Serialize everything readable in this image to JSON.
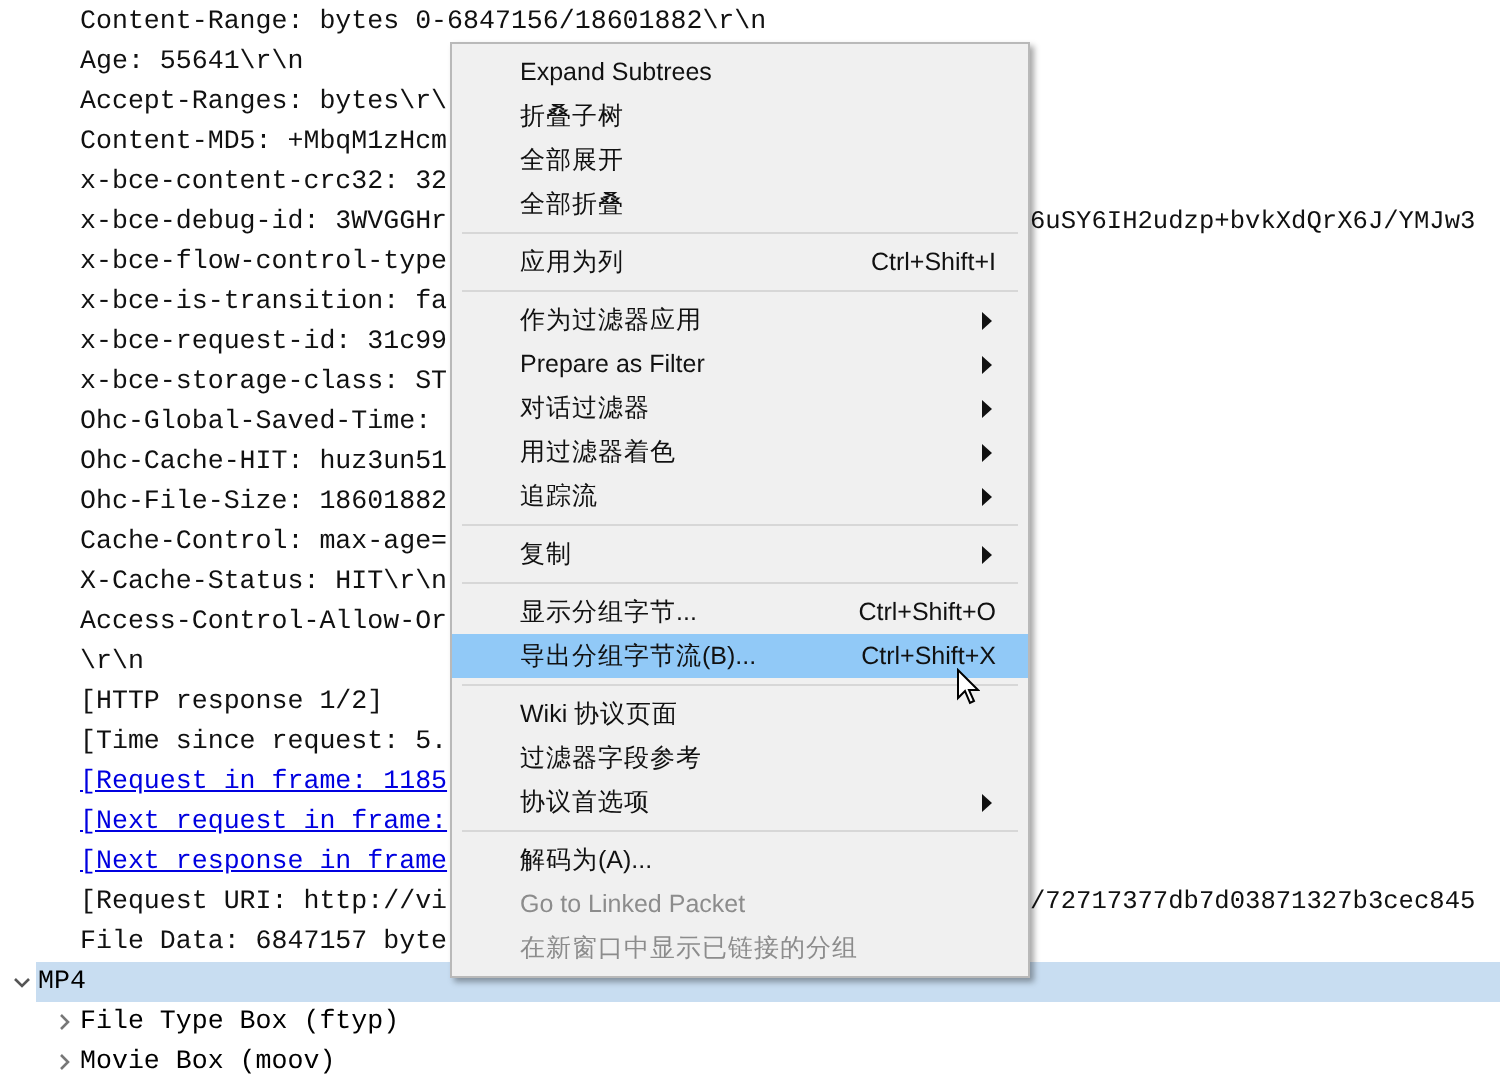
{
  "tree": [
    {
      "kind": "field",
      "text": "Content-Range: bytes 0-6847156/18601882\\r\\n",
      "selected": false
    },
    {
      "kind": "field",
      "text": "Age: 55641\\r\\n",
      "selected": false
    },
    {
      "kind": "field",
      "text": "Accept-Ranges: bytes\\r\\",
      "selected": false
    },
    {
      "kind": "field",
      "text": "Content-MD5: +MbqM1zHcm",
      "selected": false
    },
    {
      "kind": "field",
      "text": "x-bce-content-crc32: 32",
      "selected": false
    },
    {
      "kind": "field",
      "text": "x-bce-debug-id: 3WVGGHr",
      "right_text": "6uSY6IH2udzp+bvkXdQrX6J/YMJw3",
      "selected": false
    },
    {
      "kind": "field",
      "text": "x-bce-flow-control-type",
      "selected": false
    },
    {
      "kind": "field",
      "text": "x-bce-is-transition: fa",
      "selected": false
    },
    {
      "kind": "field",
      "text": "x-bce-request-id: 31c99",
      "selected": false
    },
    {
      "kind": "field",
      "text": "x-bce-storage-class: ST",
      "selected": false
    },
    {
      "kind": "field",
      "text": "Ohc-Global-Saved-Time:",
      "selected": false
    },
    {
      "kind": "field",
      "text": "Ohc-Cache-HIT: huz3un51",
      "selected": false
    },
    {
      "kind": "field",
      "text": "Ohc-File-Size: 18601882",
      "selected": false
    },
    {
      "kind": "field",
      "text": "Cache-Control: max-age=",
      "selected": false
    },
    {
      "kind": "field",
      "text": "X-Cache-Status: HIT\\r\\n",
      "selected": false
    },
    {
      "kind": "field",
      "text": "Access-Control-Allow-Or",
      "selected": false
    },
    {
      "kind": "field",
      "text": "\\r\\n",
      "selected": false
    },
    {
      "kind": "field",
      "text": "[HTTP response 1/2]",
      "selected": false
    },
    {
      "kind": "field",
      "text": "[Time since request: 5.",
      "selected": false
    },
    {
      "kind": "link",
      "text": "[Request in frame: 1185",
      "selected": false
    },
    {
      "kind": "link",
      "text": "[Next request in frame:",
      "selected": false
    },
    {
      "kind": "link",
      "text": "[Next response in frame",
      "selected": false
    },
    {
      "kind": "field",
      "text": "[Request URI: http://vi",
      "right_text": "/72717377db7d03871327b3cec845",
      "selected": false
    },
    {
      "kind": "field",
      "text": "File Data: 6847157 byte",
      "selected": false
    },
    {
      "kind": "node",
      "text": "MP4",
      "expanded": true,
      "selected": true,
      "children": [
        {
          "kind": "node",
          "text": "File Type Box (ftyp)",
          "expanded": false,
          "selected": false
        },
        {
          "kind": "node",
          "text": "Movie Box (moov)",
          "expanded": false,
          "selected": false
        }
      ]
    }
  ],
  "context_menu": [
    {
      "kind": "item",
      "label": "Expand Subtrees",
      "submenu": false,
      "disabled": false,
      "selected": false
    },
    {
      "kind": "item",
      "label": "折叠子树",
      "submenu": false,
      "disabled": false,
      "selected": false
    },
    {
      "kind": "item",
      "label": "全部展开",
      "submenu": false,
      "disabled": false,
      "selected": false
    },
    {
      "kind": "item",
      "label": "全部折叠",
      "submenu": false,
      "disabled": false,
      "selected": false
    },
    {
      "kind": "separator"
    },
    {
      "kind": "item",
      "label": "应用为列",
      "shortcut": "Ctrl+Shift+I",
      "submenu": false,
      "disabled": false,
      "selected": false
    },
    {
      "kind": "separator"
    },
    {
      "kind": "item",
      "label": "作为过滤器应用",
      "submenu": true,
      "disabled": false,
      "selected": false
    },
    {
      "kind": "item",
      "label": "Prepare as Filter",
      "submenu": true,
      "disabled": false,
      "selected": false
    },
    {
      "kind": "item",
      "label": "对话过滤器",
      "submenu": true,
      "disabled": false,
      "selected": false
    },
    {
      "kind": "item",
      "label": "用过滤器着色",
      "submenu": true,
      "disabled": false,
      "selected": false
    },
    {
      "kind": "item",
      "label": "追踪流",
      "submenu": true,
      "disabled": false,
      "selected": false
    },
    {
      "kind": "separator"
    },
    {
      "kind": "item",
      "label": "复制",
      "submenu": true,
      "disabled": false,
      "selected": false
    },
    {
      "kind": "separator"
    },
    {
      "kind": "item",
      "label": "显示分组字节...",
      "shortcut": "Ctrl+Shift+O",
      "submenu": false,
      "disabled": false,
      "selected": false
    },
    {
      "kind": "item",
      "label": "导出分组字节流(B)...",
      "shortcut": "Ctrl+Shift+X",
      "submenu": false,
      "disabled": false,
      "selected": true
    },
    {
      "kind": "separator"
    },
    {
      "kind": "item",
      "label": "Wiki 协议页面",
      "submenu": false,
      "disabled": false,
      "selected": false
    },
    {
      "kind": "item",
      "label": "过滤器字段参考",
      "submenu": false,
      "disabled": false,
      "selected": false
    },
    {
      "kind": "item",
      "label": "协议首选项",
      "submenu": true,
      "disabled": false,
      "selected": false
    },
    {
      "kind": "separator"
    },
    {
      "kind": "item",
      "label": "解码为(A)...",
      "submenu": false,
      "disabled": false,
      "selected": false
    },
    {
      "kind": "item",
      "label": "Go to Linked Packet",
      "submenu": false,
      "disabled": true,
      "selected": false
    },
    {
      "kind": "item",
      "label": "在新窗口中显示已链接的分组",
      "submenu": false,
      "disabled": true,
      "selected": false
    }
  ]
}
